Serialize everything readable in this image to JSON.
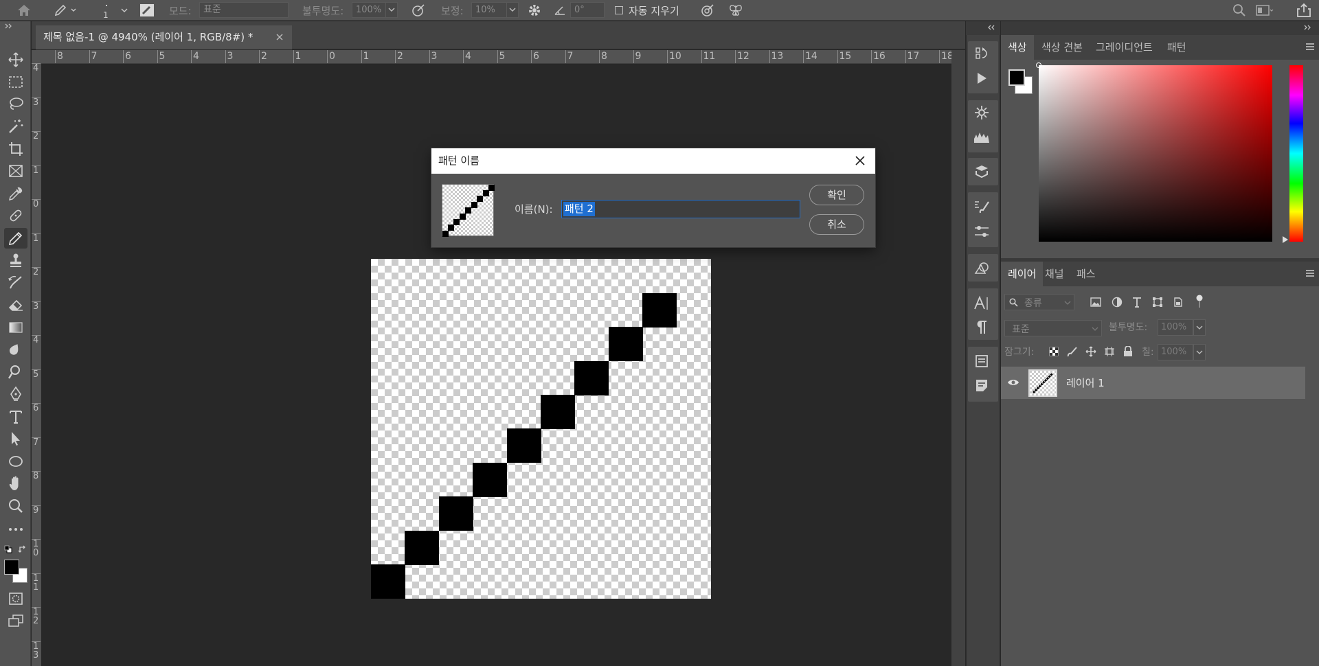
{
  "optionbar": {
    "brush_size": "1",
    "mode_label": "모드:",
    "mode_value": "표준",
    "opacity_label": "불투명도:",
    "opacity_value": "100%",
    "smoothing_label": "보정:",
    "smoothing_value": "10%",
    "angle_value": "0°",
    "auto_erase_label": "자동 지우기",
    "auto_erase_checked": false
  },
  "document": {
    "tab_title": "제목 없음-1 @ 4940% (레이어 1, RGB/8#) *"
  },
  "rulers": {
    "horizontal": [
      "8",
      "7",
      "6",
      "5",
      "4",
      "3",
      "2",
      "1",
      "0",
      "1",
      "2",
      "3",
      "4",
      "5",
      "6",
      "7",
      "8",
      "9",
      "10",
      "11",
      "12",
      "13",
      "14",
      "15",
      "16",
      "17",
      "18"
    ],
    "vertical": [
      "4",
      "3",
      "2",
      "1",
      "0",
      "1",
      "2",
      "3",
      "4",
      "5",
      "6",
      "7",
      "8",
      "9",
      "1 0",
      "1 1",
      "1 2",
      "1 3"
    ]
  },
  "color_panel": {
    "tabs": [
      "색상",
      "색상 견본",
      "그레이디언트",
      "패턴"
    ],
    "active_tab": "색상",
    "foreground": "#000000",
    "background": "#ffffff",
    "hue_color": "#ff0000"
  },
  "layers_panel": {
    "tabs": [
      "레이어",
      "채널",
      "패스"
    ],
    "active_tab": "레이어",
    "filter_label": "종류",
    "blend_mode": "표준",
    "opacity_label": "불투명도:",
    "opacity_value": "100%",
    "lock_label": "잠그기:",
    "fill_label": "칠:",
    "fill_value": "100%",
    "layers": [
      {
        "name": "레이어 1",
        "visible": true,
        "selected": true
      }
    ]
  },
  "dialog": {
    "title": "패턴 이름",
    "name_label": "이름(N):",
    "name_value": "패턴 2",
    "ok_label": "확인",
    "cancel_label": "취소"
  }
}
